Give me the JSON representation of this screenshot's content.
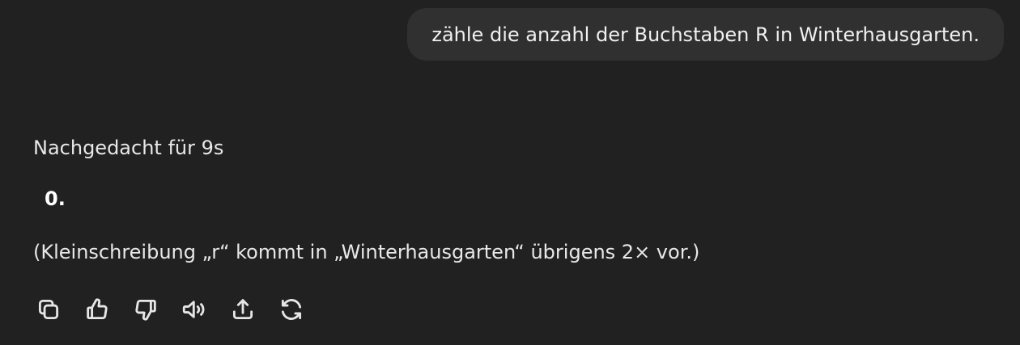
{
  "user_message": {
    "text": "zähle die anzahl der Buchstaben R in Winterhausgarten."
  },
  "assistant": {
    "thought_label": "Nachgedacht für 9s",
    "answer": "0.",
    "note": "(Kleinschreibung „r“ kommt in „Winterhausgarten“ übrigens 2× vor.)"
  },
  "actions": [
    {
      "name": "copy",
      "icon": "copy-icon"
    },
    {
      "name": "good-response",
      "icon": "thumbs-up-icon"
    },
    {
      "name": "bad-response",
      "icon": "thumbs-down-icon"
    },
    {
      "name": "read-aloud",
      "icon": "speaker-icon"
    },
    {
      "name": "share",
      "icon": "share-icon"
    },
    {
      "name": "regenerate",
      "icon": "refresh-icon"
    }
  ],
  "colors": {
    "background": "#212121",
    "user_bubble": "#303030",
    "text": "#ececec"
  }
}
